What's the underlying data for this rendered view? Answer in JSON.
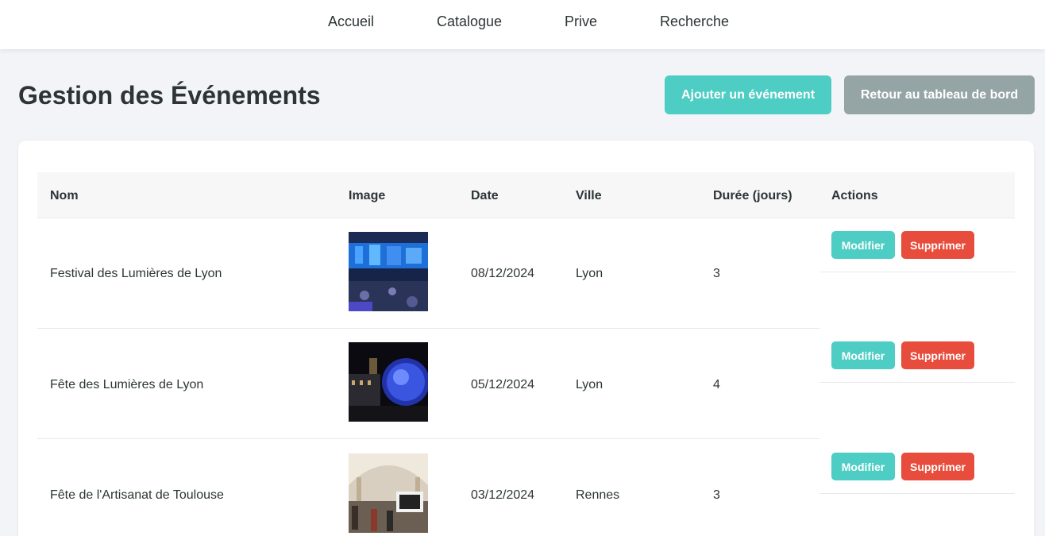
{
  "nav": {
    "items": [
      "Accueil",
      "Catalogue",
      "Prive",
      "Recherche"
    ]
  },
  "header": {
    "title": "Gestion des Événements",
    "add_label": "Ajouter un événement",
    "back_label": "Retour au tableau de bord"
  },
  "table": {
    "columns": [
      "Nom",
      "Image",
      "Date",
      "Ville",
      "Durée (jours)",
      "Actions"
    ],
    "rows": [
      {
        "name": "Festival des Lumières de Lyon",
        "date": "08/12/2024",
        "city": "Lyon",
        "duration": "3"
      },
      {
        "name": "Fête des Lumières de Lyon",
        "date": "05/12/2024",
        "city": "Lyon",
        "duration": "4"
      },
      {
        "name": "Fête de l'Artisanat de Toulouse",
        "date": "03/12/2024",
        "city": "Rennes",
        "duration": "3"
      }
    ],
    "edit_label": "Modifier",
    "delete_label": "Supprimer"
  },
  "colors": {
    "accent": "#4ecdc4",
    "secondary": "#95a5a6",
    "danger": "#e74c3c"
  }
}
